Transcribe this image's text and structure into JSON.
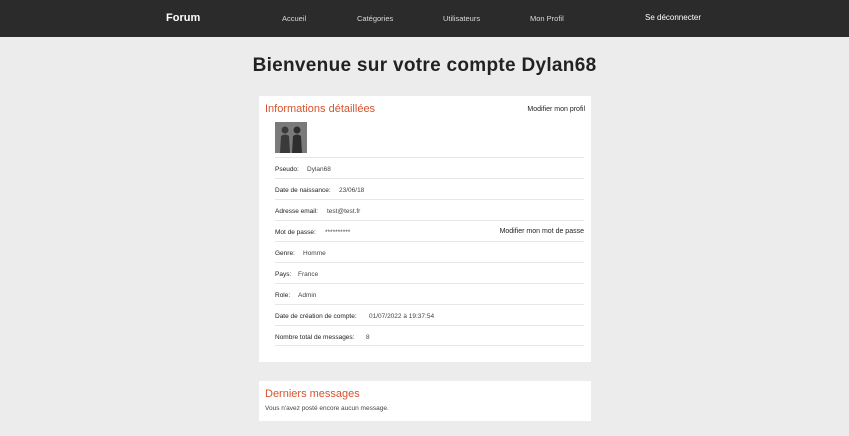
{
  "nav": {
    "brand": "Forum",
    "links": [
      "Accueil",
      "Catégories",
      "Utilisateurs",
      "Mon Profil"
    ],
    "logout": "Se déconnecter"
  },
  "welcome": "Bienvenue sur votre compte Dylan68",
  "details": {
    "title": "Informations détaillées",
    "edit_profile": "Modifier mon profil",
    "change_password": "Modifier mon mot de passe",
    "rows": [
      {
        "label": "Pseudo:",
        "value": "Dylan68"
      },
      {
        "label": "Date de naissance:",
        "value": "23/06/18"
      },
      {
        "label": "Adresse email:",
        "value": "test@test.fr"
      },
      {
        "label": "Mot de passe:",
        "value": "**********"
      },
      {
        "label": "Genre:",
        "value": "Homme"
      },
      {
        "label": "Pays:",
        "value": "France"
      },
      {
        "label": "Role:",
        "value": "Admin"
      },
      {
        "label": "Date de création de compte:",
        "value": "01/07/2022 à 19:37:54"
      },
      {
        "label": "Nombre total de messages:",
        "value": "8"
      }
    ]
  },
  "messages": {
    "title": "Derniers messages",
    "empty": "Vous n'avez posté encore aucun message."
  },
  "colors": {
    "navbar": "#2b2b2b",
    "accent": "#d6532e",
    "background": "#ececec"
  }
}
